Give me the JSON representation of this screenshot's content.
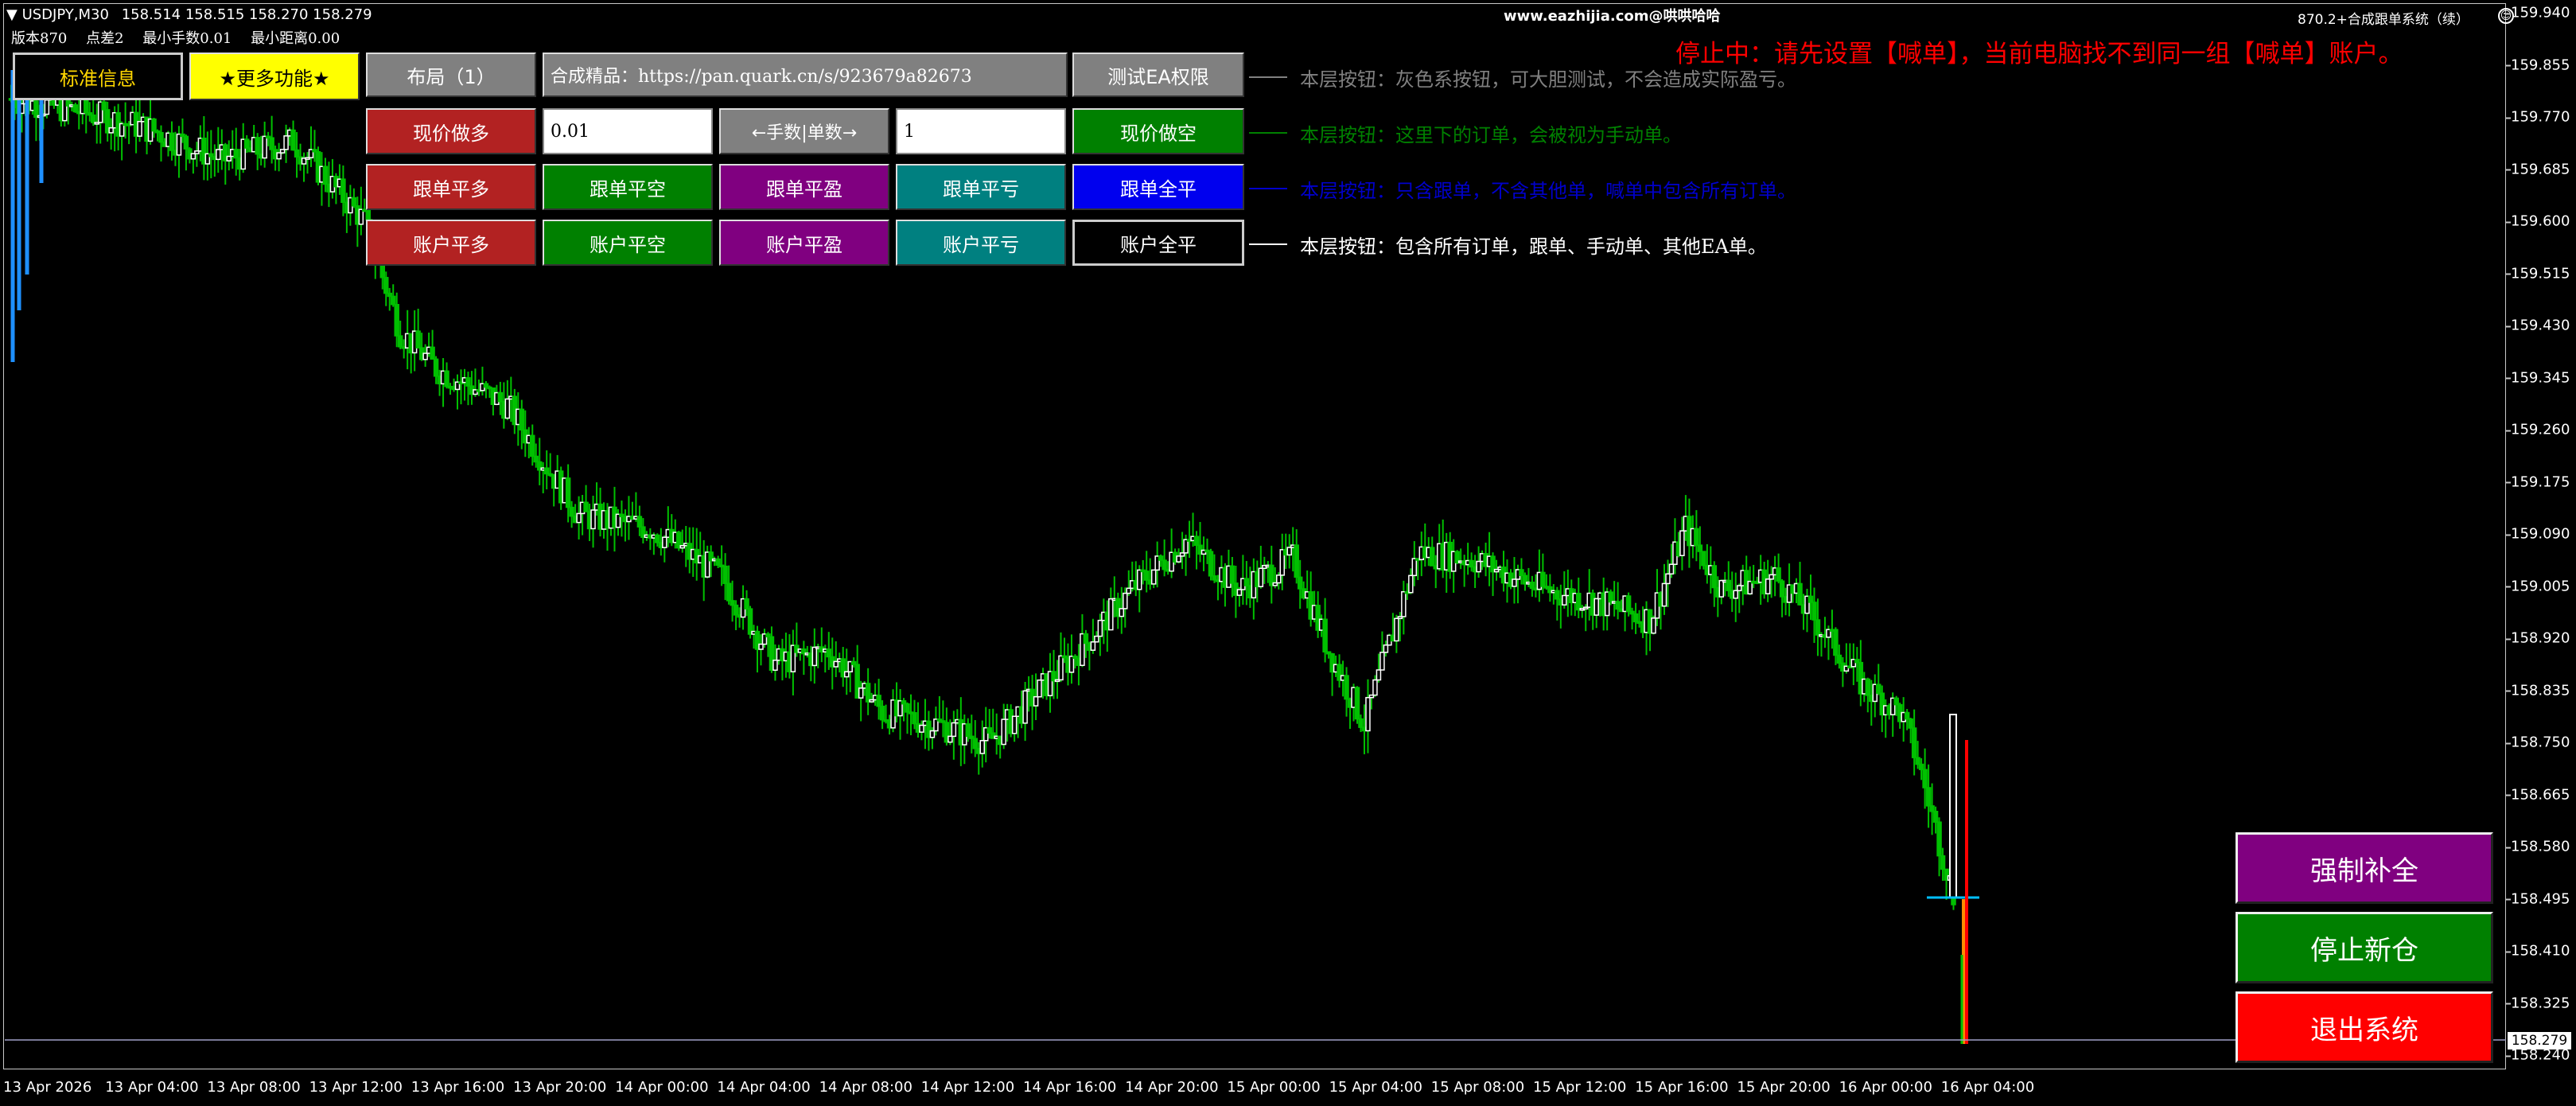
{
  "header": {
    "symbol": "USDJPY,M30",
    "quotes": "158.514 158.515 158.270 158.279",
    "version": "版本870",
    "spread": "点差2",
    "min_lot": "最小手数0.01",
    "min_distance": "最小距离0.00",
    "website": "www.eazhijia.com@哄哄哈哈",
    "ea_name": "870.2+合成跟单系统（续）",
    "status_message": "停止中：请先设置【喊单】，当前电脑找不到同一组【喊单】账户。"
  },
  "panel": {
    "tab_standard": "标准信息",
    "tab_more": "★更多功能★",
    "layout": "布局（1）",
    "link_text": "合成精品：https://pan.quark.cn/s/923679a82673",
    "test_ea": "测试EA权限",
    "buy_market": "现价做多",
    "lot_value": "0.01",
    "lot_toggle": "←手数|单数→",
    "count_value": "1",
    "sell_market": "现价做空",
    "follow_close_long": "跟单平多",
    "follow_close_short": "跟单平空",
    "follow_close_profit": "跟单平盈",
    "follow_close_loss": "跟单平亏",
    "follow_close_all": "跟单全平",
    "acct_close_long": "账户平多",
    "acct_close_short": "账户平空",
    "acct_close_profit": "账户平盈",
    "acct_close_loss": "账户平亏",
    "acct_close_all": "账户全平",
    "note_row1": "本层按钮：灰色系按钮，可大胆测试，不会造成实际盈亏。",
    "note_row2": "本层按钮：这里下的订单，会被视为手动单。",
    "note_row3": "本层按钮：只含跟单，不含其他单，喊单中包含所有订单。",
    "note_row4": "本层按钮：包含所有订单，跟单、手动单、其他EA单。"
  },
  "actions": {
    "force_fill": "强制补全",
    "stop_new": "停止新仓",
    "exit_system": "退出系统"
  },
  "price_axis": [
    "159.940",
    "159.855",
    "159.770",
    "159.685",
    "159.600",
    "159.515",
    "159.430",
    "159.345",
    "159.260",
    "159.175",
    "159.090",
    "159.005",
    "158.920",
    "158.835",
    "158.750",
    "158.665",
    "158.580",
    "158.495",
    "158.410",
    "158.325",
    "158.240"
  ],
  "current_price": "158.279",
  "time_axis": [
    "13 Apr 2026",
    "13 Apr 04:00",
    "13 Apr 08:00",
    "13 Apr 12:00",
    "13 Apr 16:00",
    "13 Apr 20:00",
    "14 Apr 00:00",
    "14 Apr 04:00",
    "14 Apr 08:00",
    "14 Apr 12:00",
    "14 Apr 16:00",
    "14 Apr 20:00",
    "15 Apr 00:00",
    "15 Apr 04:00",
    "15 Apr 08:00",
    "15 Apr 12:00",
    "15 Apr 16:00",
    "15 Apr 20:00",
    "16 Apr 00:00",
    "16 Apr 04:00"
  ],
  "colors": {
    "bull": "#ffffff",
    "bear": "#00c000",
    "btn_gray": "#808080",
    "btn_red": "#b22222",
    "btn_green": "#008000",
    "btn_purple": "#800080",
    "btn_teal": "#008080",
    "btn_blue": "#0000ee",
    "btn_yellow": "#ffff00",
    "status_red": "#ff0000"
  }
}
